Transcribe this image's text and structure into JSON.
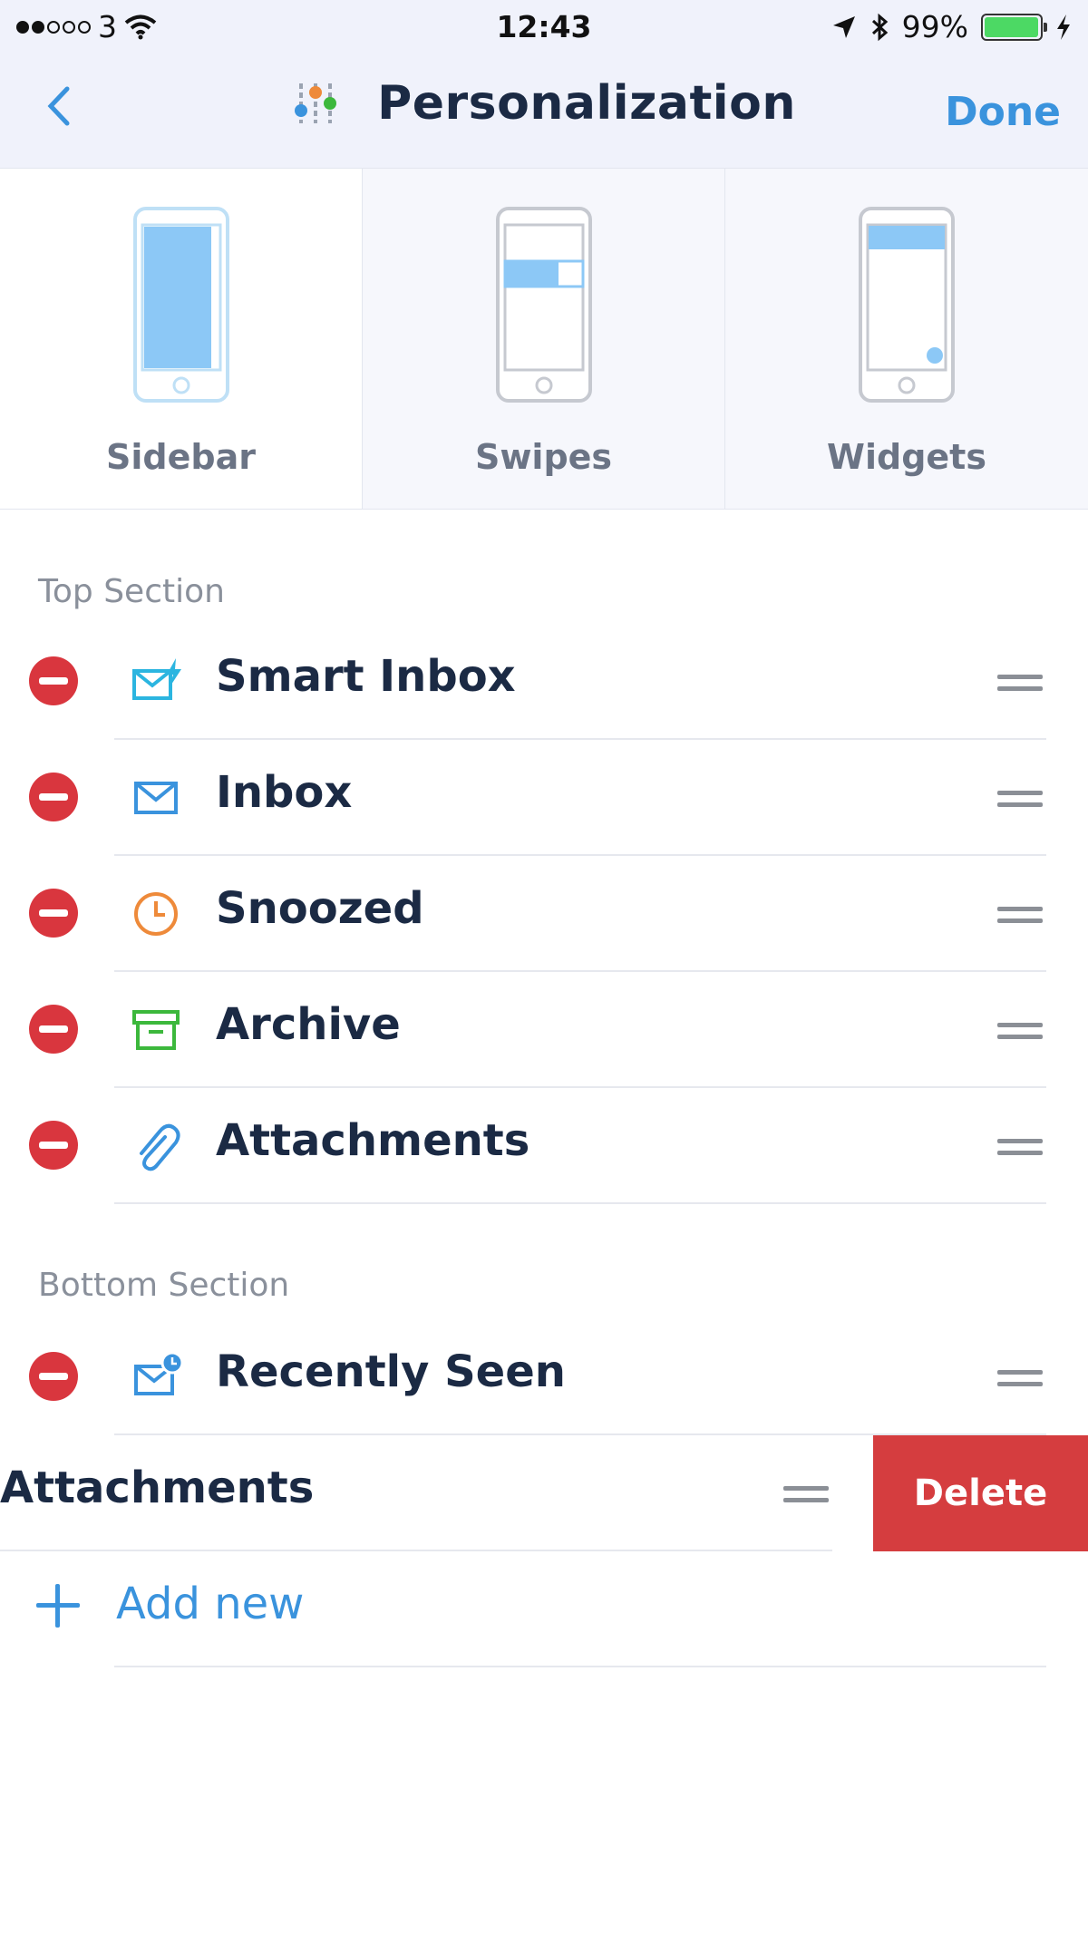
{
  "status_bar": {
    "carrier": "3",
    "time": "12:43",
    "battery": "99%",
    "battery_level": 0.99
  },
  "nav": {
    "title": "Personalization",
    "done_label": "Done"
  },
  "modes": [
    {
      "label": "Sidebar",
      "selected": true
    },
    {
      "label": "Swipes",
      "selected": false
    },
    {
      "label": "Widgets",
      "selected": false
    }
  ],
  "top_section": {
    "title": "Top Section",
    "items": [
      {
        "label": "Smart Inbox",
        "icon": "smart-inbox-icon",
        "color": "#2bb5e0"
      },
      {
        "label": "Inbox",
        "icon": "inbox-icon",
        "color": "#3a93dd"
      },
      {
        "label": "Snoozed",
        "icon": "clock-icon",
        "color": "#ee8a3a"
      },
      {
        "label": "Archive",
        "icon": "archive-icon",
        "color": "#3cb83c"
      },
      {
        "label": "Attachments",
        "icon": "paperclip-icon",
        "color": "#3a93dd"
      }
    ]
  },
  "bottom_section": {
    "title": "Bottom Section",
    "items": [
      {
        "label": "Recently Seen",
        "icon": "recently-seen-icon",
        "color": "#3a93dd"
      }
    ],
    "swiped_item": {
      "label": "Attachments",
      "delete_label": "Delete"
    }
  },
  "add_new_label": "Add new",
  "colors": {
    "accent": "#3a93dd",
    "delete": "#d53d3f",
    "remove": "#d9363e"
  }
}
